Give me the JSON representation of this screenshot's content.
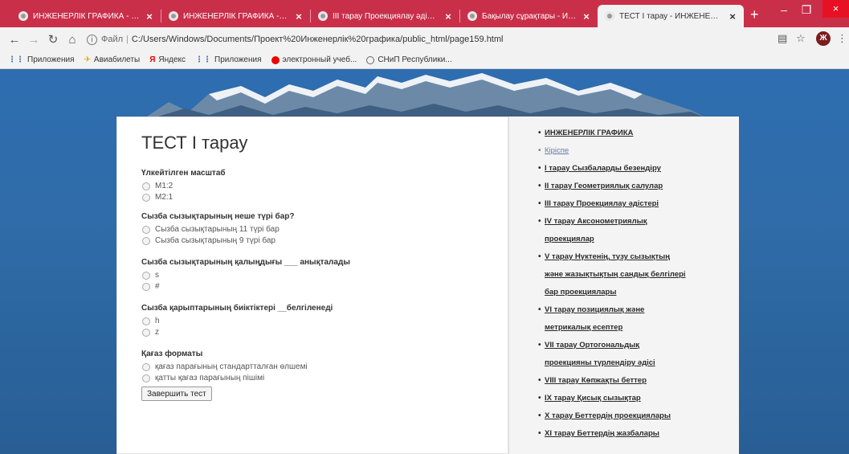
{
  "browser": {
    "tabs": [
      {
        "title": "ИНЖЕНЕРЛІК ГРАФИКА - ИНЖ",
        "active": false
      },
      {
        "title": "ИНЖЕНЕРЛІК ГРАФИКА - ИНЖ",
        "active": false
      },
      {
        "title": "III тарау Проекциялау әдістері",
        "active": false
      },
      {
        "title": "Бақылау сұрақтары - ИНЖЕНЕ",
        "active": false
      },
      {
        "title": "ТЕСТ I тарау - ИНЖЕНЕРЛІК ГР",
        "active": true
      }
    ],
    "new_tab": "+",
    "close_glyph": "×",
    "address": {
      "scheme": "Файл",
      "url": "C:/Users/Windows/Documents/Проект%20Инженерлік%20графика/public_html/page159.html"
    },
    "profile_letter": "Ж",
    "bookmarks": [
      {
        "label": "Приложения",
        "icon": "apps-grid-icon"
      },
      {
        "label": "Авиабилеты",
        "icon": "plane-icon"
      },
      {
        "label": "Яндекс",
        "icon": "yandex-icon"
      },
      {
        "label": "Приложения",
        "icon": "apps-grid-icon"
      },
      {
        "label": "электронный учеб...",
        "icon": "red-dot-icon"
      },
      {
        "label": "СНиП Республики...",
        "icon": "globe-icon"
      }
    ]
  },
  "page": {
    "title": "ТЕСТ I тарау",
    "questions": [
      {
        "label": "Үлкейтілген масштаб",
        "options": [
          "M1:2",
          "M2:1"
        ]
      },
      {
        "label": "Сызба сызықтарының неше түрі бар?",
        "options": [
          "Сызба сызықтарының 11 түрі бар",
          "Сызба сызықтарының 9 түрі бар"
        ]
      },
      {
        "label": "Сызба сызықтарының қалыңдығы ___ анықталады",
        "options": [
          "s",
          "#"
        ]
      },
      {
        "label": "Сызба қарыптарының биіктіктері __белгіленеді",
        "options": [
          "h",
          "z"
        ]
      },
      {
        "label": "Қағаз форматы",
        "options": [
          "қағаз парағының стандартталған өлшемі",
          "қатты қағаз парағының пішімі"
        ]
      }
    ],
    "finish_button": "Завершить тест",
    "sidebar": [
      {
        "label": "ИНЖЕНЕРЛІК ГРАФИКА",
        "plain": false
      },
      {
        "label": "Кіріспе",
        "plain": true
      },
      {
        "label": "I тарау Сызбаларды безендіру",
        "plain": false
      },
      {
        "label": "II тарау Геометриялық салулар",
        "plain": false
      },
      {
        "label": "III тарау Проекциялау әдістері",
        "plain": false
      },
      {
        "label": "IV тарау Аксонометриялық",
        "plain": false,
        "cont": "проекциялар"
      },
      {
        "label": "V тарау Нүктенің, түзу сызықтың",
        "plain": false,
        "cont": [
          "және жазықтықтың сандық белгілері",
          "бар проекциялары"
        ]
      },
      {
        "label": "VI тарау позициялық және",
        "plain": false,
        "cont": "метрикалық есептер"
      },
      {
        "label": "VII тарау Ортогональдық",
        "plain": false,
        "cont": "проекцияны түрлендіру әдісі"
      },
      {
        "label": "VIII тарау Көпжақты беттер",
        "plain": false
      },
      {
        "label": "IX тарау Қисық сызықтар",
        "plain": false
      },
      {
        "label": "X тарау Беттердің проекциялары",
        "plain": false
      },
      {
        "label": "XI тарау Беттердің жазбалары",
        "plain": false
      }
    ]
  }
}
